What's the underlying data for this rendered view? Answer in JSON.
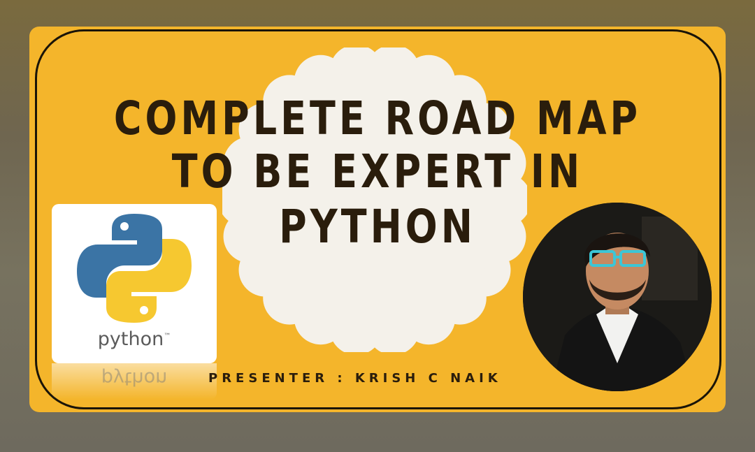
{
  "thumbnail": {
    "headline_line1": "COMPLETE ROAD MAP",
    "headline_line2": "TO BE EXPERT IN",
    "headline_line3": "PYTHON",
    "logo_text": "python",
    "logo_trademark": "™",
    "presenter": "PRESENTER : KRISH C NAIK"
  },
  "colors": {
    "background": "#f4b52b",
    "headline": "#2a1d0c",
    "python_blue": "#3b74a5",
    "python_yellow": "#f6c830"
  },
  "icons": [
    "python-logo-icon",
    "presenter-photo"
  ]
}
